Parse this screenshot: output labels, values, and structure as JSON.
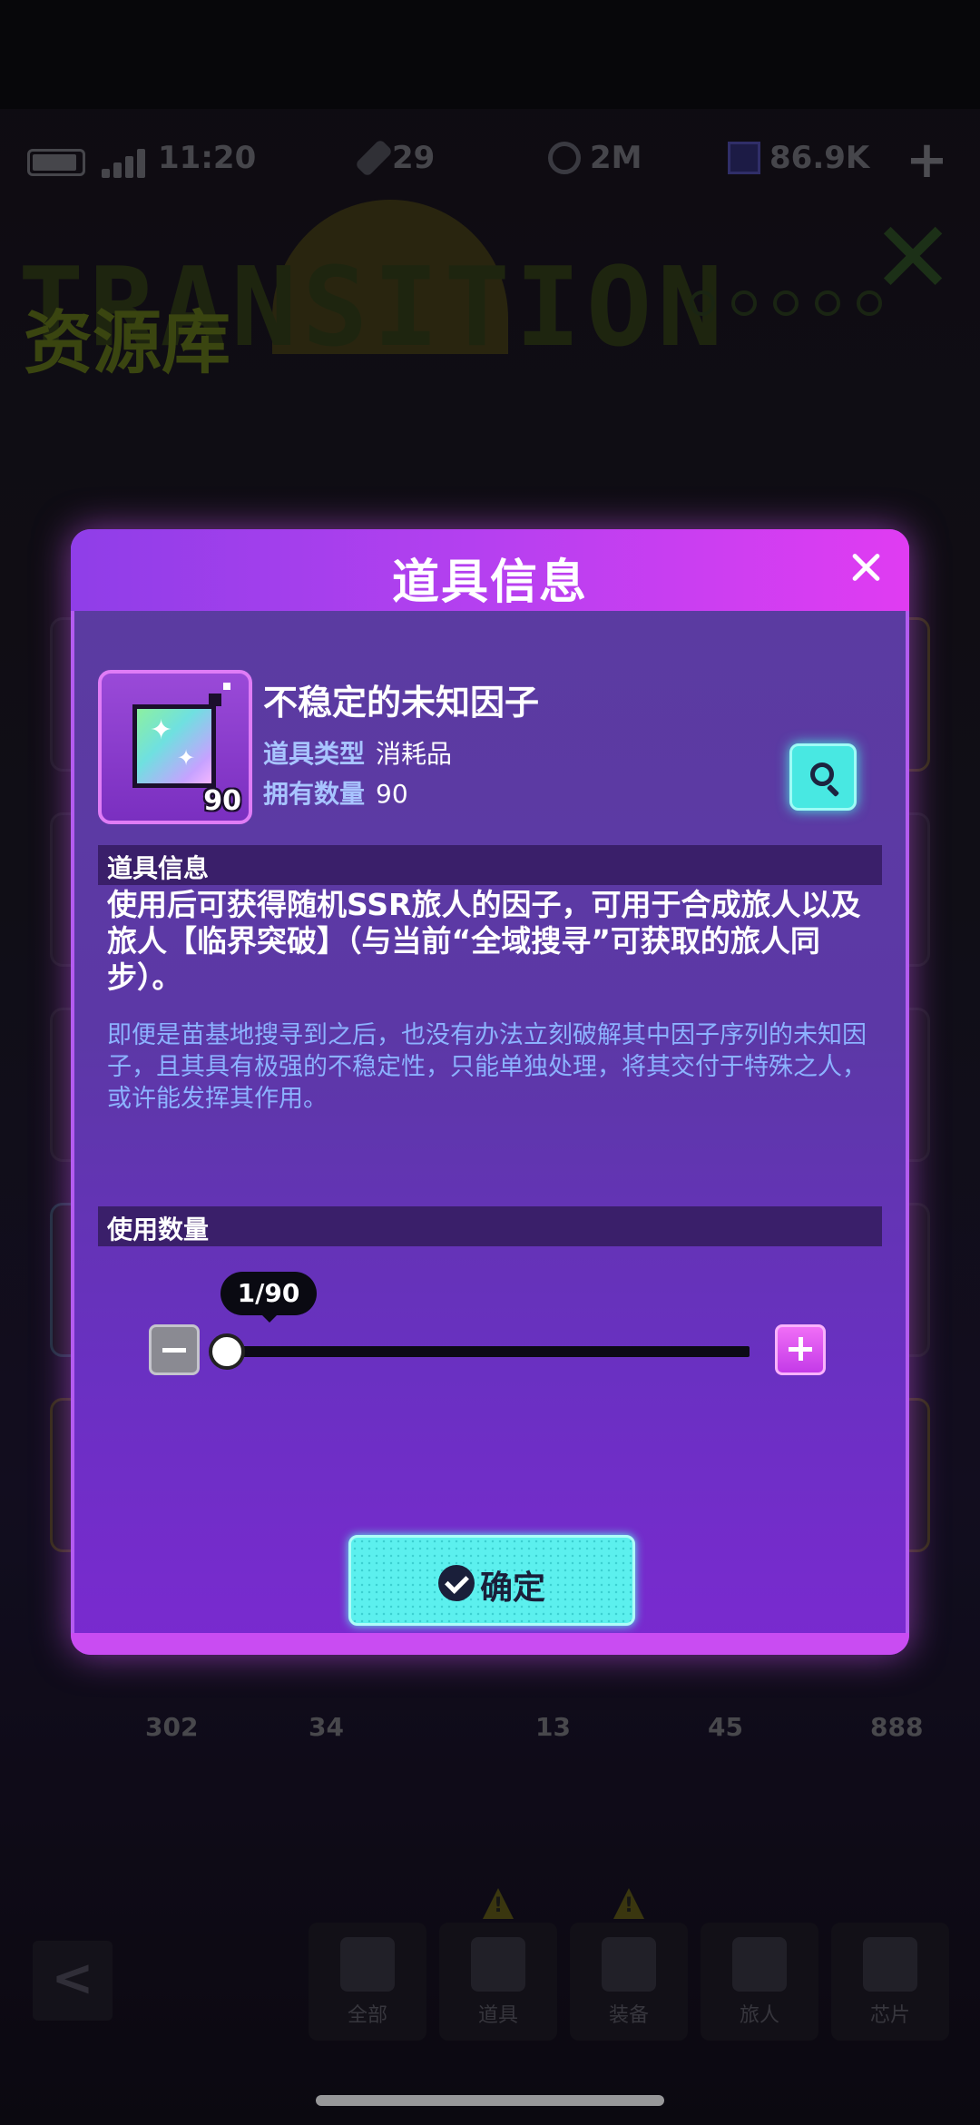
{
  "status_bar": {
    "time": "11:20",
    "stamina": "29",
    "coins": "2M",
    "gems": "86.9K",
    "plus_label": "+"
  },
  "banner": {
    "title": "资源库",
    "logo_text": "TRANSITION"
  },
  "background_grid": {
    "bottom_counts": [
      "302",
      "34",
      "13",
      "45",
      "888"
    ]
  },
  "bottom_nav": {
    "back_label": "<",
    "tabs": [
      {
        "label": "全部",
        "warn": false
      },
      {
        "label": "道具",
        "warn": true
      },
      {
        "label": "装备",
        "warn": true
      },
      {
        "label": "旅人",
        "warn": false
      },
      {
        "label": "芯片",
        "warn": false
      }
    ]
  },
  "modal": {
    "title": "道具信息",
    "item": {
      "name": "不稳定的未知因子",
      "count_badge": "90",
      "type_label": "道具类型",
      "type_value": "消耗品",
      "owned_label": "拥有数量",
      "owned_value": "90",
      "icon": "rainbow-cube-icon"
    },
    "info_section_label": "道具信息",
    "description": "使用后可获得随机SSR旅人的因子，可用于合成旅人以及旅人【临界突破】（与当前“全域搜寻”可获取的旅人同步）。",
    "flavor_text": "即便是苗基地搜寻到之后，也没有办法立刻破解其中因子序列的未知因子，且其具有极强的不稳定性，只能单独处理，将其交付于特殊之人，或许能发挥其作用。",
    "quantity_section_label": "使用数量",
    "quantity": {
      "current": 1,
      "max": 90,
      "tooltip": "1/90"
    },
    "confirm_label": "确定"
  }
}
